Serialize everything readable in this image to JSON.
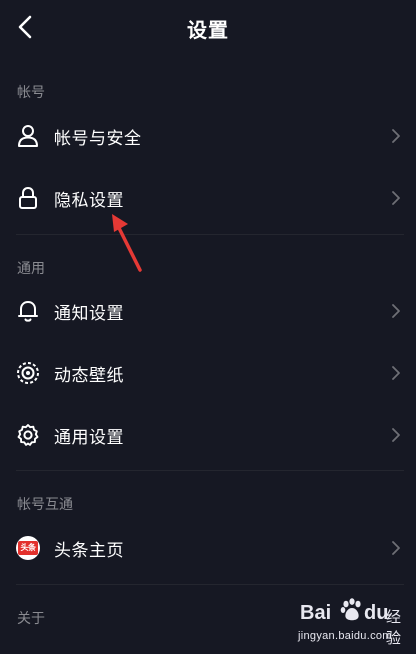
{
  "header": {
    "title": "设置"
  },
  "sections": {
    "account": {
      "label": "帐号",
      "items": [
        {
          "label": "帐号与安全",
          "icon": "person-icon"
        },
        {
          "label": "隐私设置",
          "icon": "lock-icon"
        }
      ]
    },
    "general": {
      "label": "通用",
      "items": [
        {
          "label": "通知设置",
          "icon": "bell-icon"
        },
        {
          "label": "动态壁纸",
          "icon": "live-wallpaper-icon"
        },
        {
          "label": "通用设置",
          "icon": "gear-icon"
        }
      ]
    },
    "interop": {
      "label": "帐号互通",
      "items": [
        {
          "label": "头条主页",
          "icon": "toutiao-logo",
          "logo_text": "头条"
        }
      ]
    },
    "about": {
      "label": "关于"
    }
  },
  "watermark": {
    "brand_left": "Bai",
    "brand_right": "du",
    "brand_cn": "经验",
    "url": "jingyan.baidu.com"
  },
  "colors": {
    "background": "#161823",
    "section_label": "#8a8b91",
    "divider": "#24262f",
    "annotation_arrow": "#e53935"
  }
}
